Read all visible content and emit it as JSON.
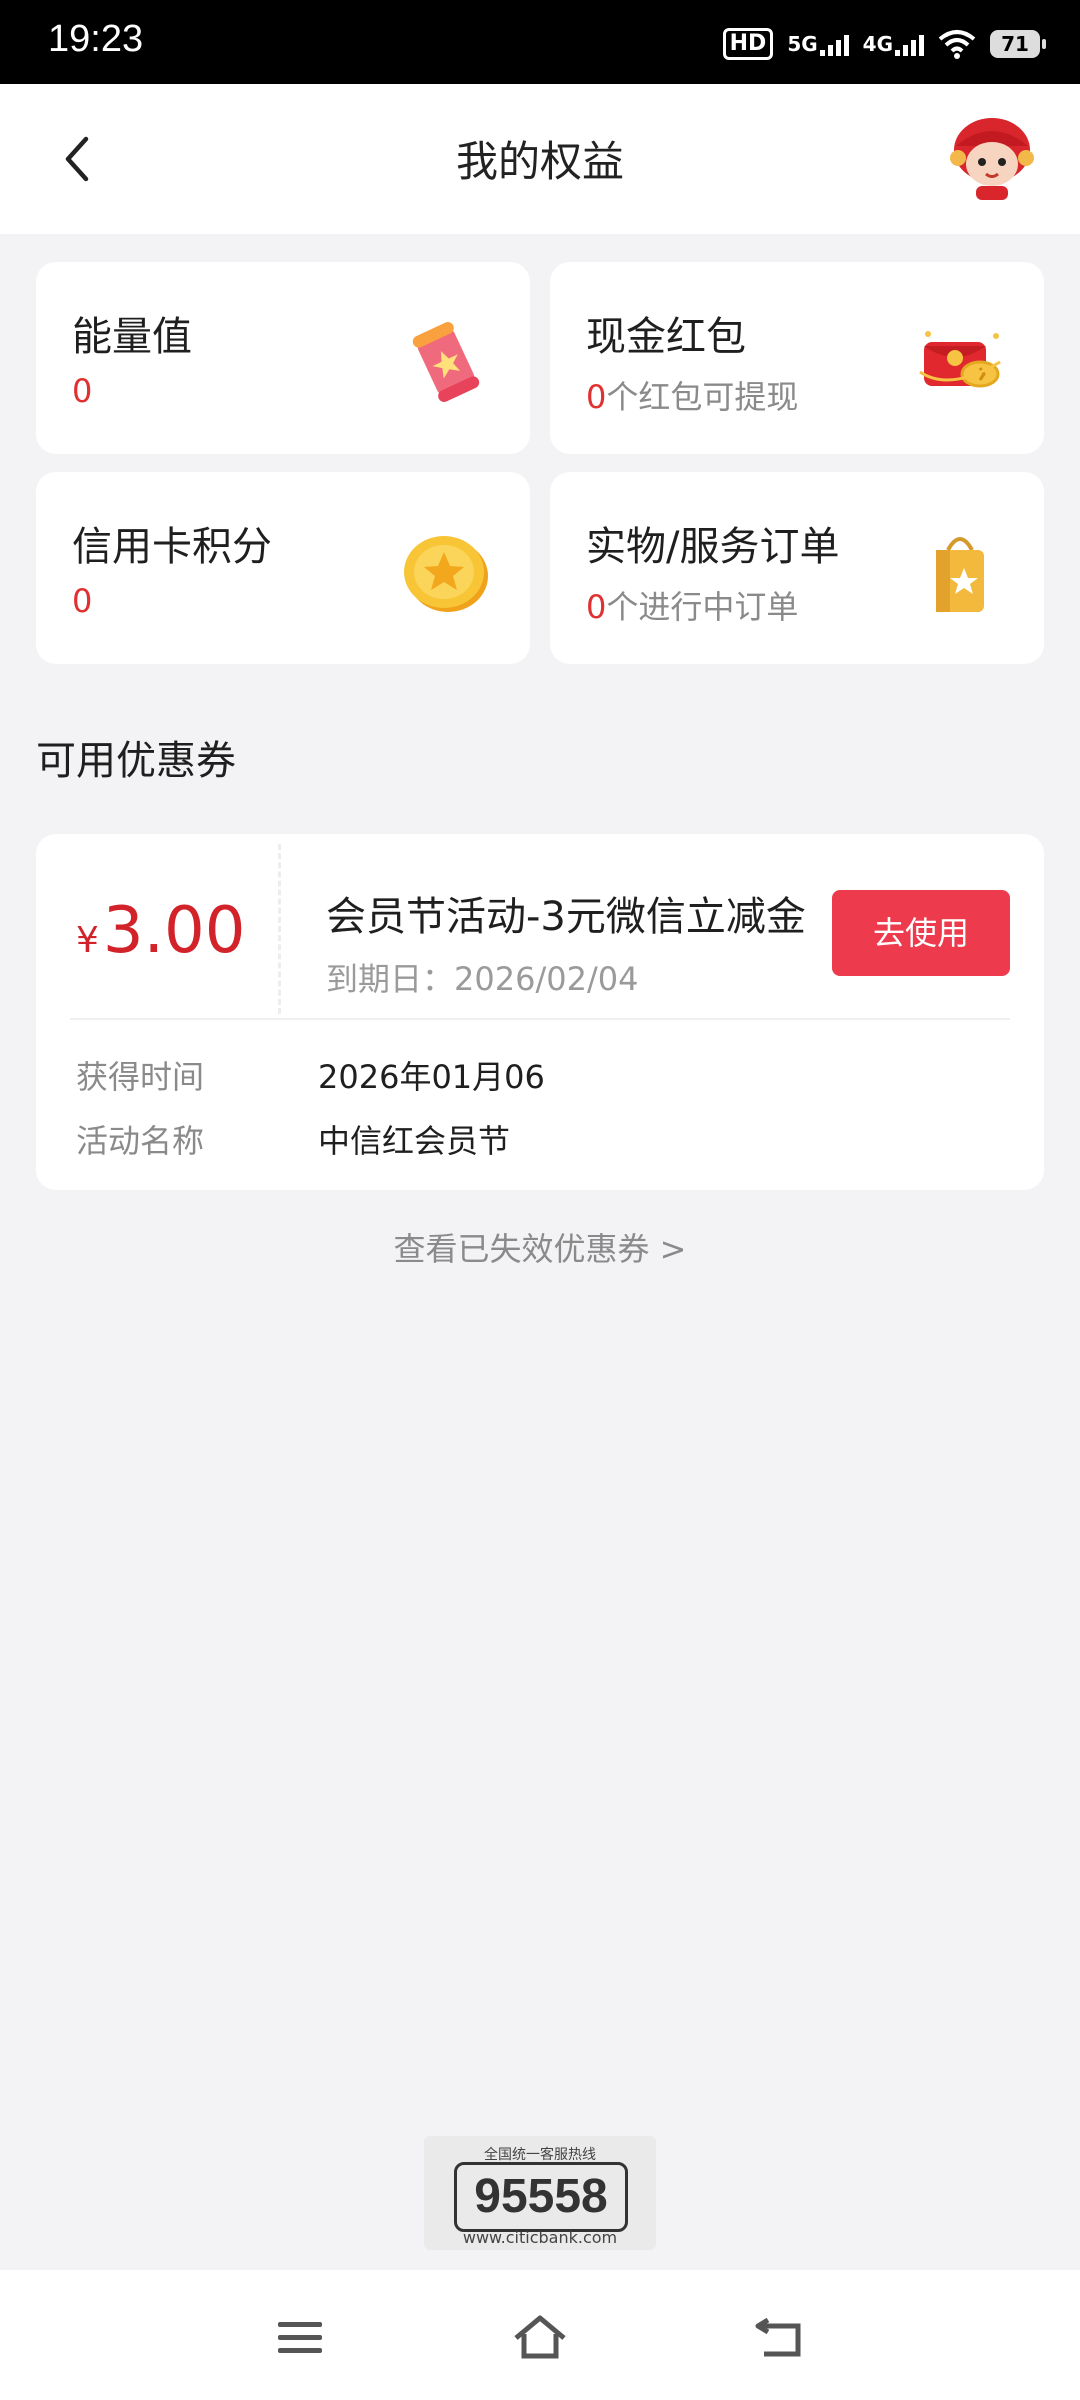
{
  "status_bar": {
    "time": "19:23",
    "hd_label": "HD",
    "net1": "5G",
    "net2": "4G",
    "battery": "71"
  },
  "header": {
    "title": "我的权益",
    "back_icon": "chevron-left-icon",
    "avatar_icon": "mascot-avatar"
  },
  "cards": {
    "energy": {
      "title": "能量值",
      "value": "0",
      "icon": "energy-scroll-icon"
    },
    "cash": {
      "title": "现金红包",
      "value": "0",
      "sub": "个红包可提现",
      "icon": "red-packet-icon"
    },
    "points": {
      "title": "信用卡积分",
      "value": "0",
      "icon": "star-coin-icon"
    },
    "orders": {
      "title": "实物/服务订单",
      "value": "0",
      "sub": "个进行中订单",
      "icon": "shopping-bag-icon"
    }
  },
  "coupons": {
    "section_title": "可用优惠券",
    "item": {
      "currency": "¥",
      "amount": "3.00",
      "name": "会员节活动-3元微信立减金",
      "expiry_label": "到期日：",
      "expiry_date": "2026/02/04",
      "button": "去使用",
      "obtained_label": "获得时间",
      "obtained_value": "2026年01月06",
      "activity_label": "活动名称",
      "activity_value": "中信红会员节"
    },
    "expired_link": "查看已失效优惠券 >"
  },
  "hotline": {
    "title": "全国统一客服热线",
    "number": "95558",
    "url": "www.citicbank.com"
  },
  "navbar": {
    "menu_icon": "menu-icon",
    "home_icon": "home-icon",
    "back_icon": "back-icon"
  },
  "colors": {
    "accent_red": "#d2232a",
    "button_red": "#ed3a4c",
    "background": "#f3f3f5"
  }
}
